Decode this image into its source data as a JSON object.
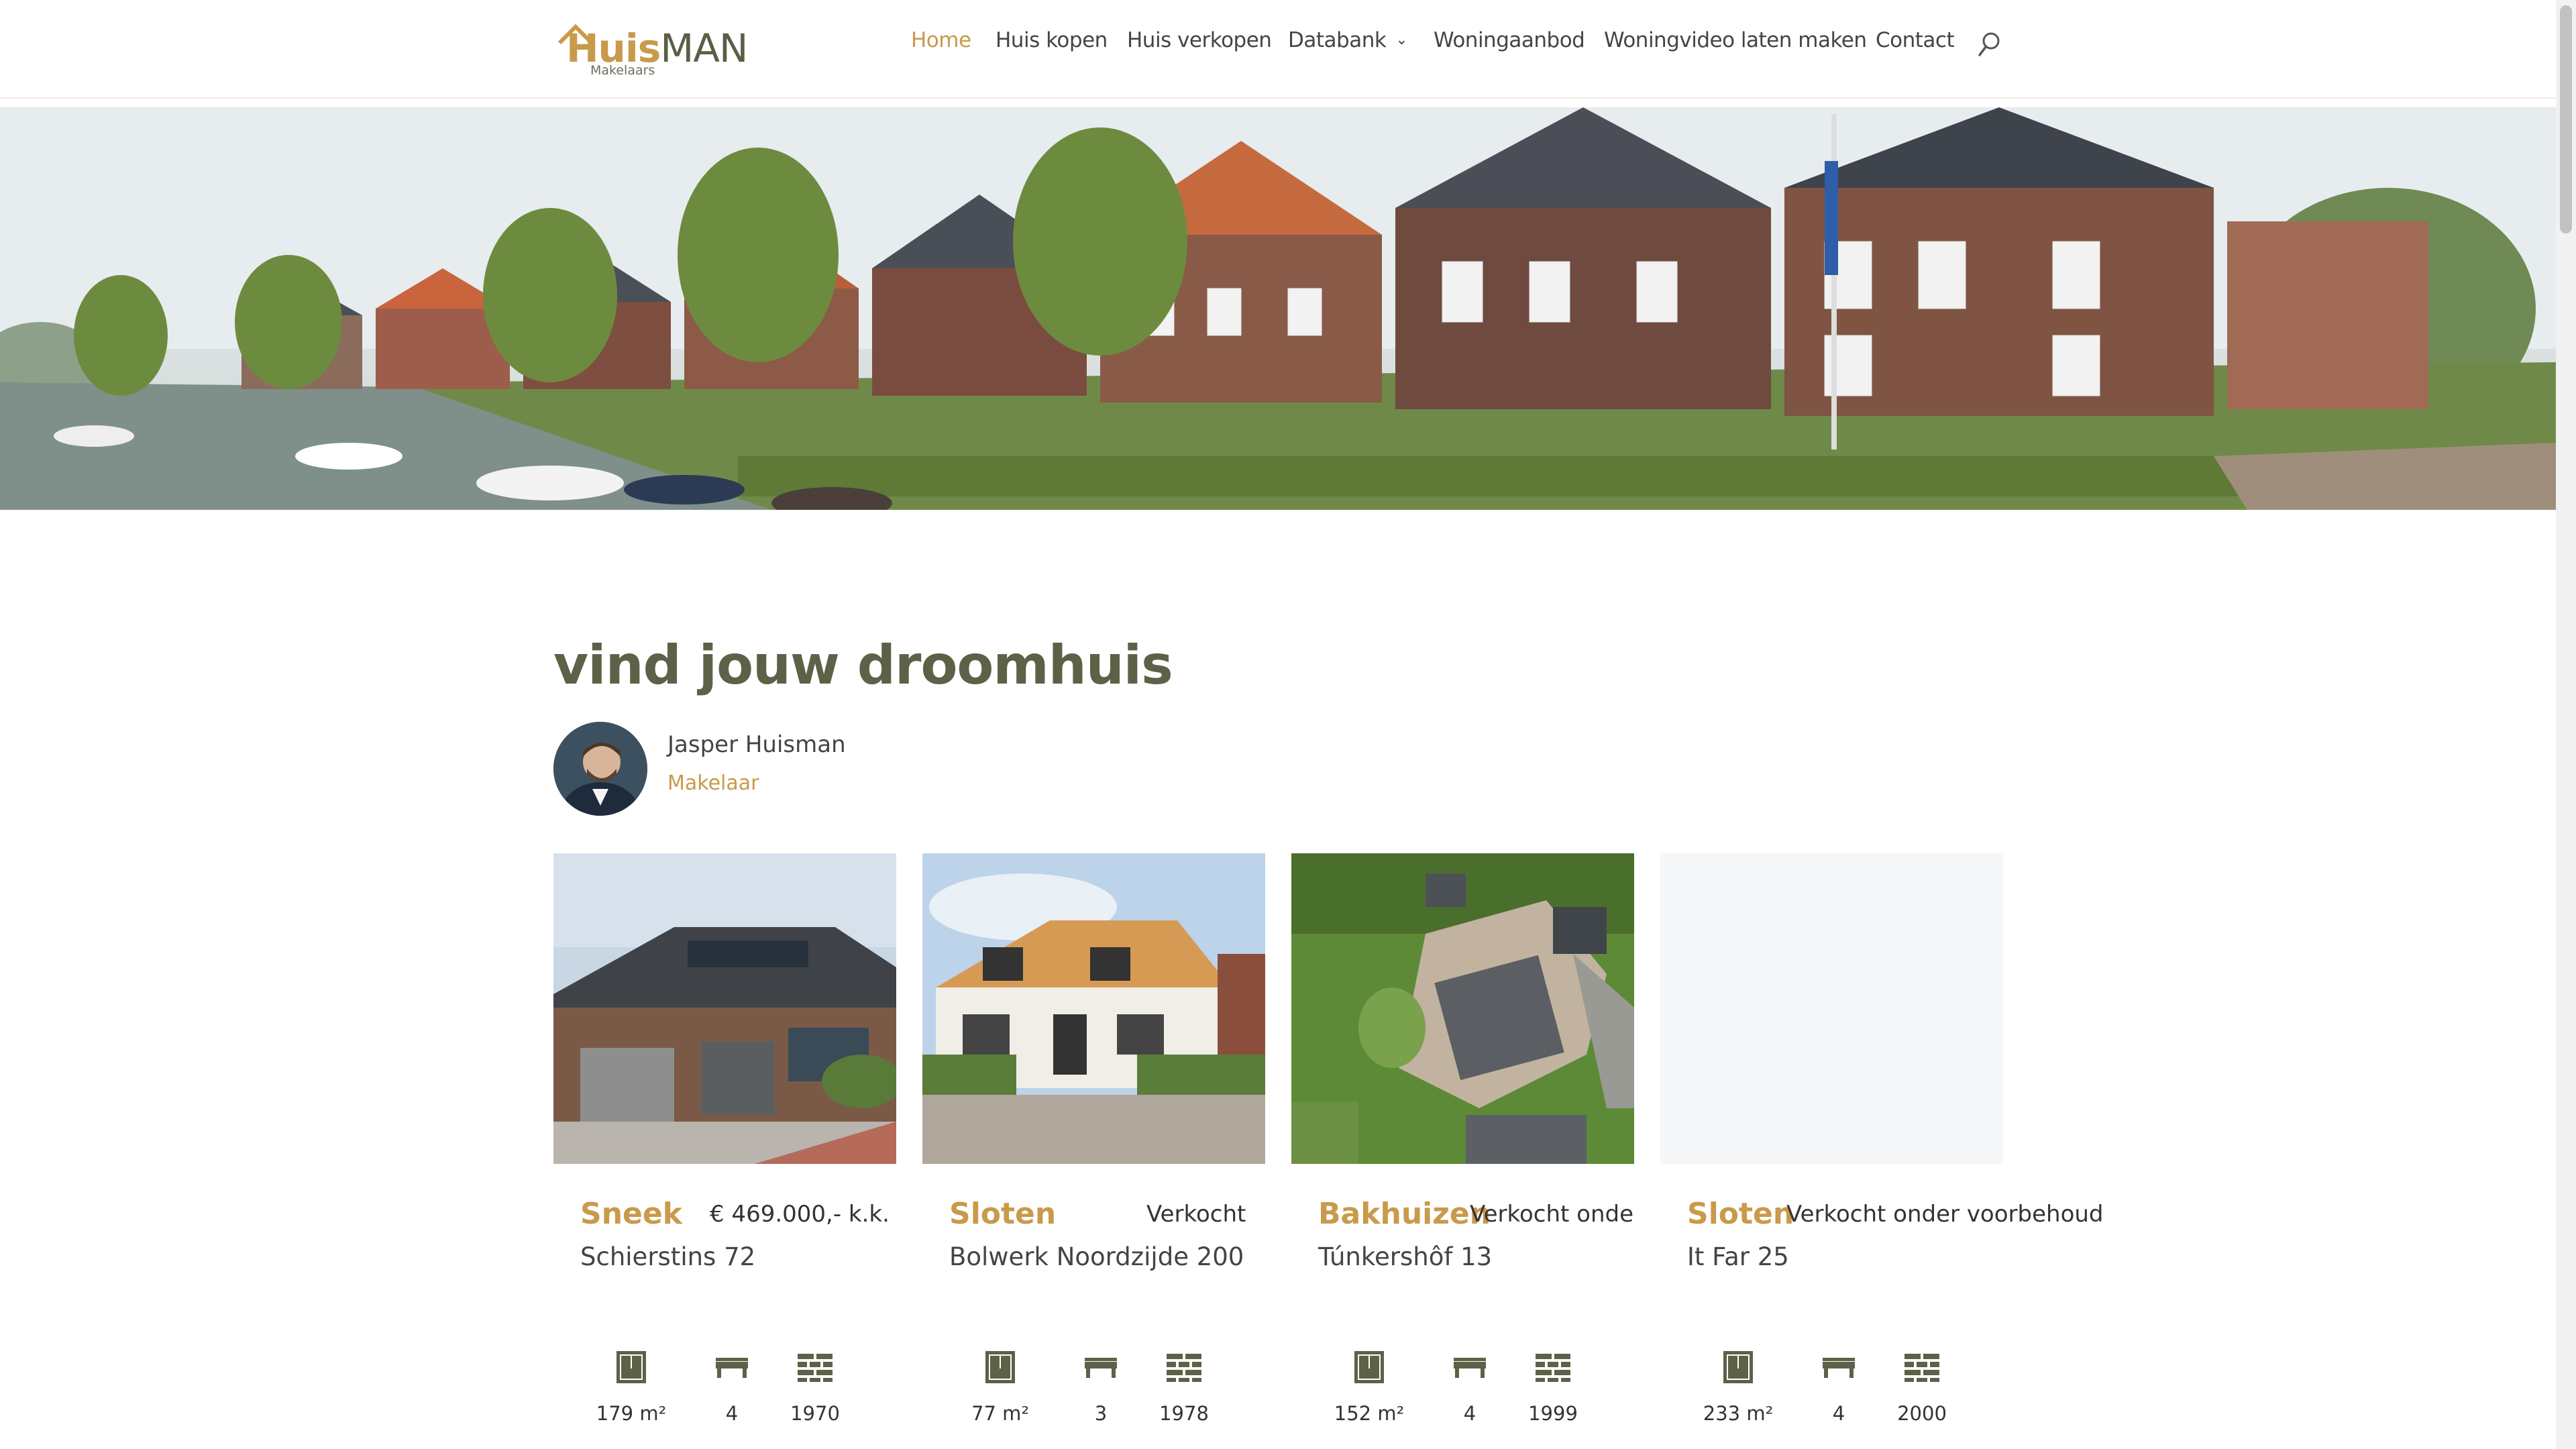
{
  "header": {
    "logo_main_1": "H",
    "logo_main_2": "uis",
    "logo_main_3": "MAN",
    "logo_sub": "Makelaars",
    "nav": [
      {
        "label": "Home",
        "active": true
      },
      {
        "label": "Huis kopen"
      },
      {
        "label": "Huis verkopen"
      },
      {
        "label": "Databank",
        "has_dropdown": true
      },
      {
        "label": "Woningaanbod"
      },
      {
        "label": "Woningvideo laten maken"
      },
      {
        "label": "Contact"
      }
    ],
    "search_icon": "search-icon"
  },
  "main": {
    "headline": "vind jouw droomhuis",
    "agent": {
      "name": "Jasper Huisman",
      "role": "Makelaar"
    }
  },
  "listings": [
    {
      "city": "Sneek",
      "status": "€ 469.000,- k.k.",
      "street": "Schierstins 72",
      "area": "179 m²",
      "rooms": "4",
      "year": "1970"
    },
    {
      "city": "Sloten",
      "status": "Verkocht",
      "street": "Bolwerk Noordzijde 200",
      "area": "77 m²",
      "rooms": "3",
      "year": "1978"
    },
    {
      "city": "Bakhuizen",
      "status": "Verkocht onder vo",
      "street": "Túnkershôf 13",
      "area": "152 m²",
      "rooms": "4",
      "year": "1999"
    },
    {
      "city": "Sloten",
      "status": "Verkocht onder voorbehoud",
      "street": "It Far 25",
      "area": "233 m²",
      "rooms": "4",
      "year": "2000"
    }
  ],
  "colors": {
    "accent": "#c89a4b",
    "olive": "#5d6147"
  }
}
